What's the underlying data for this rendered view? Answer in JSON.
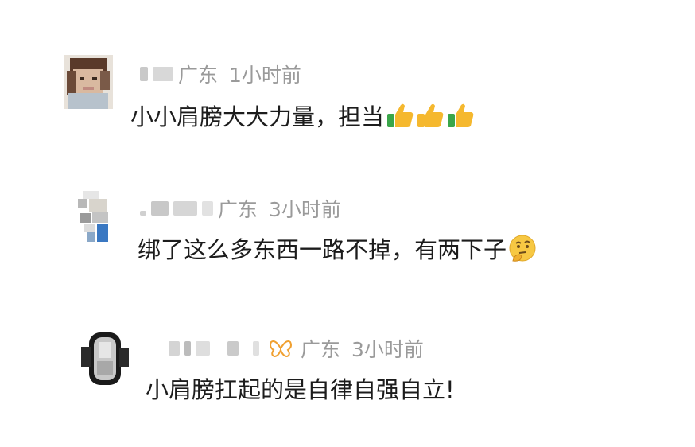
{
  "comments": [
    {
      "location": "广东",
      "time": "1小时前",
      "text": "小小肩膀大大力量，担当",
      "emojis": [
        "thumbs-up",
        "thumbs-up",
        "thumbs-up"
      ]
    },
    {
      "location": "广东",
      "time": "3小时前",
      "text": "绑了这么多东西一路不掉，有两下子",
      "emojis": [
        "thinking-face"
      ]
    },
    {
      "location": "广东",
      "time": "3小时前",
      "text": "小肩膀扛起的是自律自强自立!",
      "badge_icon": "butterfly-badge-icon"
    }
  ]
}
